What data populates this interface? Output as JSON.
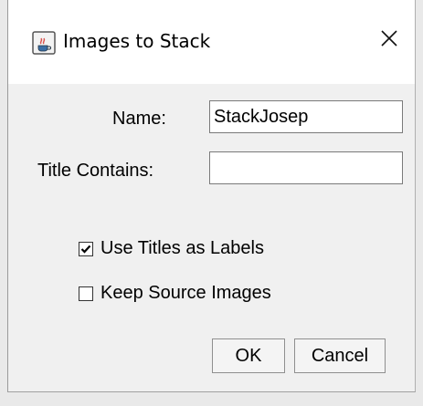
{
  "window": {
    "title": "Images to Stack",
    "close_glyph": "✕"
  },
  "form": {
    "name_label": "Name:",
    "name_value": "StackJosep",
    "title_contains_label": "Title Contains:",
    "title_contains_value": ""
  },
  "options": [
    {
      "label": "Use Titles as Labels",
      "checked": true
    },
    {
      "label": "Keep Source Images",
      "checked": false
    }
  ],
  "buttons": {
    "ok_label": "OK",
    "cancel_label": "Cancel"
  },
  "icons": {
    "app": "java-coffee-icon",
    "close": "close-icon"
  }
}
